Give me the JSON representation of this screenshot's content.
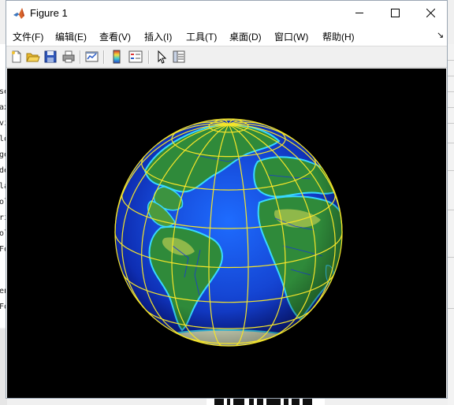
{
  "background_editor": {
    "line_fragments": [
      "se",
      "ax",
      "vi",
      "lo",
      "ge",
      "de",
      "la",
      "ol",
      "ri",
      "ol",
      "Fo",
      "en",
      "Fo",
      "en"
    ]
  },
  "window": {
    "title": "Figure 1",
    "icon": "matlab-logo-icon",
    "controls": [
      "minimize-icon",
      "maximize-icon",
      "close-icon"
    ]
  },
  "menu": {
    "items": [
      {
        "label": "文件(F)"
      },
      {
        "label": "编辑(E)"
      },
      {
        "label": "查看(V)"
      },
      {
        "label": "插入(I)"
      },
      {
        "label": "工具(T)"
      },
      {
        "label": "桌面(D)"
      },
      {
        "label": "窗口(W)"
      },
      {
        "label": "帮助(H)"
      }
    ],
    "dock_arrow": "↘"
  },
  "toolbar": {
    "buttons": [
      {
        "icon": "new-figure-icon"
      },
      {
        "icon": "open-file-icon"
      },
      {
        "icon": "save-icon"
      },
      {
        "icon": "print-icon"
      },
      {
        "icon": "link-plot-icon"
      },
      {
        "icon": "insert-colorbar-icon"
      },
      {
        "icon": "insert-legend-icon"
      },
      {
        "icon": "edit-plot-arrow-icon"
      },
      {
        "icon": "property-inspector-icon"
      }
    ]
  },
  "figure": {
    "content": "3D globe with topography and latitude/longitude grid",
    "colors": {
      "background": "#000000",
      "ocean_deep": "#0a1f9e",
      "ocean_shallow": "#1e6cff",
      "coast_shelf": "#38d8ff",
      "land": "#2f8a3a",
      "land_light": "#8fb84a",
      "grid": "#f5e52a",
      "borders": "#1c3ad0"
    }
  }
}
